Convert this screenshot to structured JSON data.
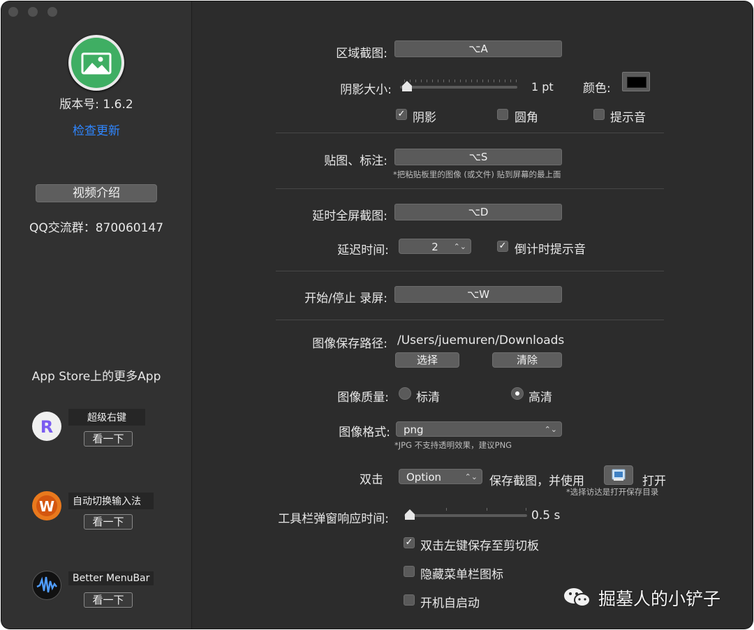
{
  "sidebar": {
    "version": "版本号: 1.6.2",
    "check_update": "检查更新",
    "video_intro": "视频介绍",
    "qq_group": "QQ交流群：870060147",
    "more_apps_title": "App Store上的更多App",
    "apps": [
      {
        "name": "超级右键",
        "look": "看一下"
      },
      {
        "name": "自动切换输入法",
        "look": "看一下"
      },
      {
        "name": "Better MenuBar",
        "look": "看一下"
      }
    ]
  },
  "region": {
    "label": "区域截图:",
    "shortcut": "⌥A",
    "shadow_size_label": "阴影大小:",
    "shadow_size_value": "1 pt",
    "color_label": "颜色:",
    "color_value": "#000000",
    "shadow_cb": "阴影",
    "round_cb": "圆角",
    "sound_cb": "提示音"
  },
  "pin": {
    "label": "贴图、标注:",
    "shortcut": "⌥S",
    "hint": "*把粘贴板里的图像 (或文件) 贴到屏幕的最上面"
  },
  "delay": {
    "label": "延时全屏截图:",
    "shortcut": "⌥D",
    "time_label": "延迟时间:",
    "time_value": "2",
    "countdown_cb": "倒计时提示音"
  },
  "record": {
    "label": "开始/停止 录屏:",
    "shortcut": "⌥W"
  },
  "save": {
    "path_label": "图像保存路径:",
    "path_value": "/Users/juemuren/Downloads",
    "choose_btn": "选择",
    "clear_btn": "清除",
    "quality_label": "图像质量:",
    "quality_sd": "标清",
    "quality_hd": "高清",
    "format_label": "图像格式:",
    "format_value": "png",
    "format_hint": "*JPG 不支持透明效果，建议PNG"
  },
  "double_click": {
    "label": "双击",
    "key_value": "Option",
    "text1": "保存截图，并使用",
    "text2": "打开",
    "hint": "*选择访达是打开保存目录"
  },
  "toolbar": {
    "label": "工具栏弹窗响应时间:",
    "value": "0.5 s",
    "dblclick_cb": "双击左键保存至剪切板",
    "hide_icon_cb": "隐藏菜单栏图标",
    "autostart_cb": "开机自启动"
  },
  "watermark": "掘墓人的小铲子",
  "colors": {
    "accent_link": "#2f86ff",
    "app_icon_green": "#3fae63"
  },
  "icons": {
    "check": "✓"
  }
}
